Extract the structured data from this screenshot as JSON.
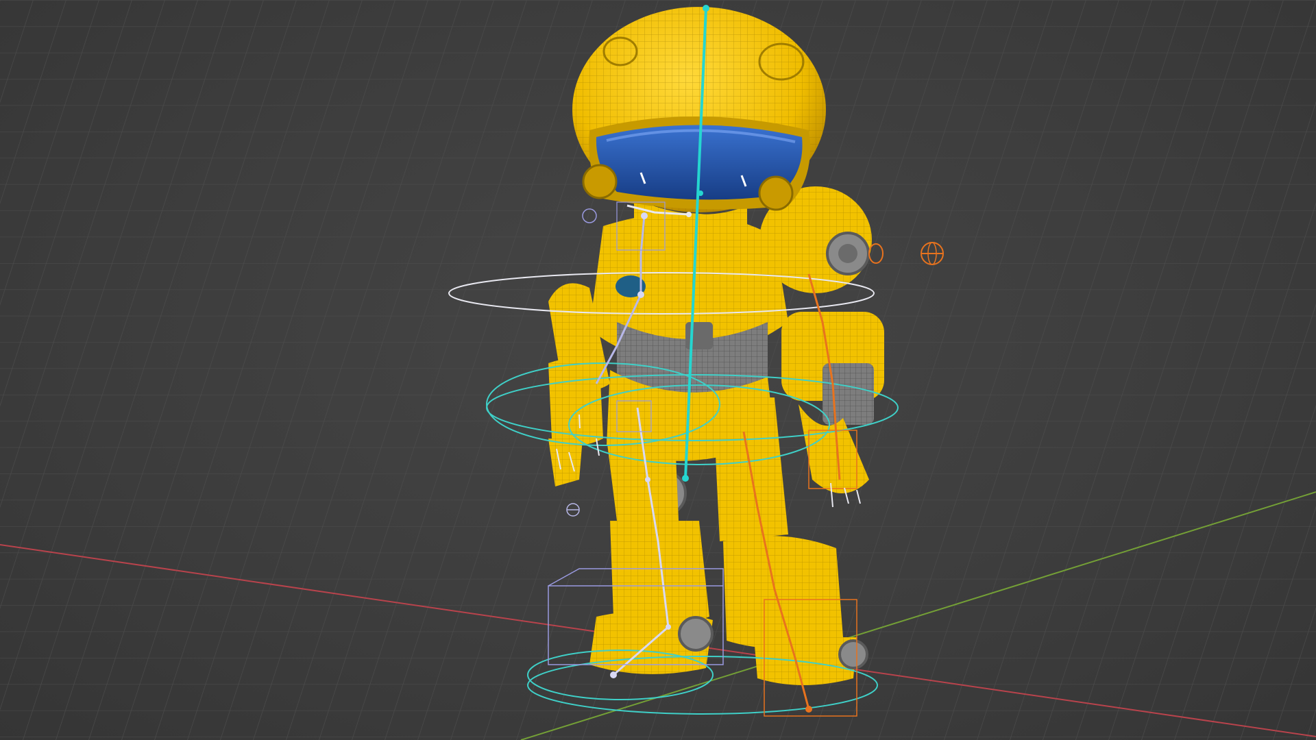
{
  "viewport": {
    "background_color": "#3d3d3d",
    "grid_color": "#4e4e4e",
    "x_axis_color": "#c0474f",
    "y_axis_color": "#7aa33a"
  },
  "model": {
    "name": "yellow-robot-character",
    "body_color": "#f2c200",
    "shadow_color": "#c99a00",
    "joint_color": "#7d7d7d",
    "visor_color": "#1f4fa8"
  },
  "rig": {
    "spine_color": "#25d6d0",
    "control_cyan": "#3fd0c8",
    "control_white": "#e8e8f0",
    "bone_lavender": "#b8b8e8",
    "control_orange": "#e8731e"
  }
}
